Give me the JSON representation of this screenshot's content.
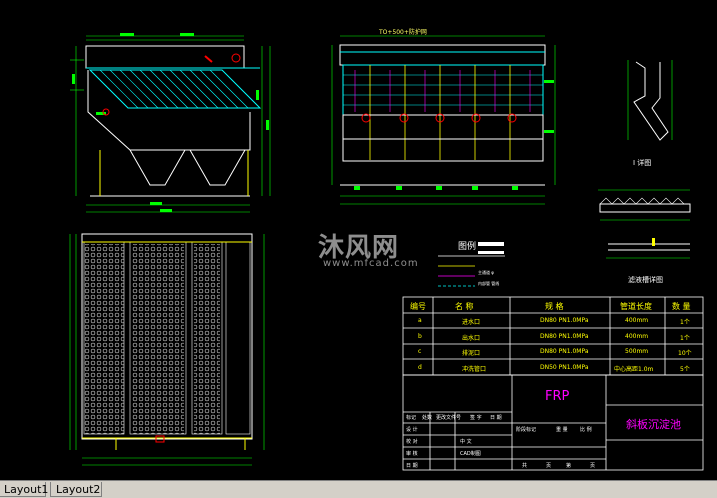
{
  "watermark": {
    "name": "沐风网",
    "url": "www.mfcad.com"
  },
  "labels": {
    "legend_title": "图例",
    "legend_items": [
      "主通道 φ",
      "内部管 管线"
    ],
    "detail_1": "I 详图",
    "detail_2": "滤液槽详图",
    "top_note": "TO+500+防护网"
  },
  "table": {
    "headers": [
      "编号",
      "名 称",
      "规 格",
      "管道长度",
      "数 量"
    ],
    "rows": [
      [
        "a",
        "进水口",
        "DN80 PN1.0MPa",
        "400mm",
        "1个"
      ],
      [
        "b",
        "出水口",
        "DN80 PN1.0MPa",
        "400mm",
        "1个"
      ],
      [
        "c",
        "排泥口",
        "DN80 PN1.0MPa",
        "500mm",
        "10个"
      ],
      [
        "d",
        "冲洗管口",
        "DN50 PN1.0MPa",
        "中心高距1.0m",
        "5个"
      ]
    ]
  },
  "title_block": {
    "material": "FRP",
    "project": "斜板沉淀池",
    "rows": [
      "设 计",
      "校 对",
      "审 核",
      "日 期"
    ],
    "header_cells": [
      "标记",
      "处数",
      "更改文件号",
      "签 字",
      "日 期"
    ],
    "sign_cells": [
      "阶段标记",
      "重 量",
      "比 例"
    ],
    "footer_cells": [
      "共",
      "页",
      "第",
      "页"
    ],
    "company": "中 文",
    "cad_label": "CAD制图"
  },
  "tabs": [
    {
      "label": "Layout1"
    },
    {
      "label": "Layout2"
    }
  ],
  "colors": {
    "background": "#000000",
    "cyan": "#00ffff",
    "green": "#00ff00",
    "yellow": "#ffff00",
    "magenta": "#ff00ff",
    "white": "#ffffff",
    "red": "#ff0000"
  }
}
